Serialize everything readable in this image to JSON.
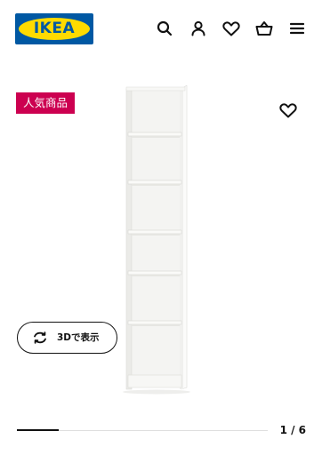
{
  "header": {
    "logo_text": "IKEA",
    "icons": [
      "search-icon",
      "user-icon",
      "heart-icon",
      "basket-icon",
      "menu-icon"
    ]
  },
  "product": {
    "badge": "人気商品",
    "image": "white-narrow-bookcase",
    "favorite_icon": "heart-icon"
  },
  "view_3d": {
    "icon": "rotate-3d-icon",
    "label": "3Dで表示"
  },
  "gallery": {
    "current": 1,
    "total": 6,
    "counter_label": "1 / 6",
    "progress_fraction": 0.167
  },
  "colors": {
    "brand_blue": "#0058A3",
    "brand_yellow": "#FFDB00",
    "badge_bg": "#CC0050",
    "text": "#111111"
  }
}
